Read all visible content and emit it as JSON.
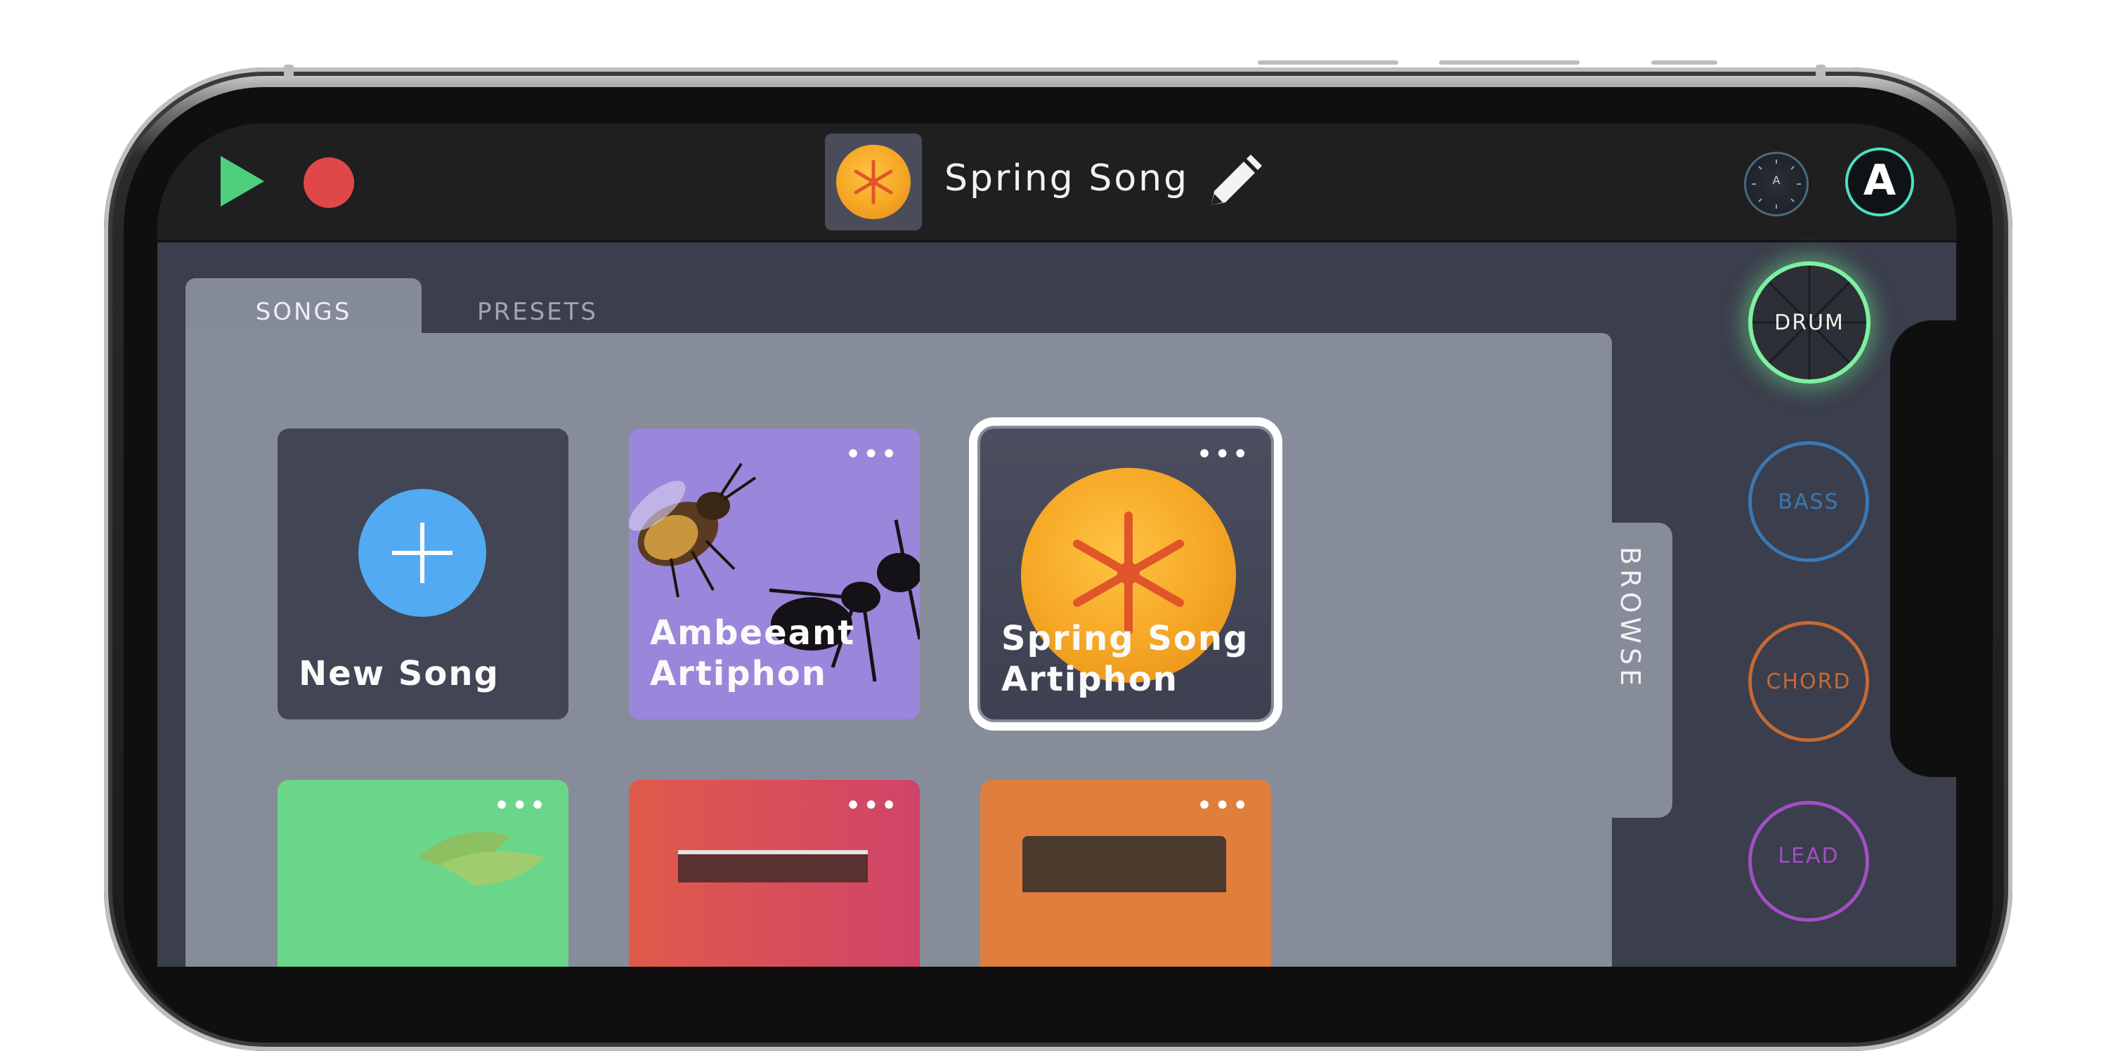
{
  "header": {
    "song_title": "Spring Song",
    "play_color": "#4ecf7e",
    "record_color": "#e04848",
    "knob_label": "A",
    "logo_letter": "A"
  },
  "tabs": [
    {
      "label": "SONGS",
      "active": true
    },
    {
      "label": "PRESETS",
      "active": false
    }
  ],
  "side_tab": {
    "label": "BROWSE"
  },
  "cards": [
    {
      "label_line1": "New Song",
      "label_line2": "",
      "type": "new",
      "icon": "plus-icon"
    },
    {
      "label_line1": "Ambeeant",
      "label_line2": "Artiphon",
      "menu": "•••"
    },
    {
      "label_line1": "Spring Song",
      "label_line2": "Artiphon",
      "menu": "•••",
      "selected": true
    },
    {
      "label_line1": "",
      "label_line2": "",
      "menu": "•••"
    },
    {
      "label_line1": "",
      "label_line2": "",
      "menu": "•••"
    },
    {
      "label_line1": "",
      "label_line2": "",
      "menu": "•••"
    }
  ],
  "instruments": [
    {
      "label": "DRUM",
      "color": "#7ef0a0",
      "active": true
    },
    {
      "label": "BASS",
      "color": "#3a78b4",
      "active": false
    },
    {
      "label": "CHORD",
      "color": "#c46a34",
      "active": false
    },
    {
      "label": "LEAD",
      "color": "#a050c4",
      "active": false
    }
  ]
}
